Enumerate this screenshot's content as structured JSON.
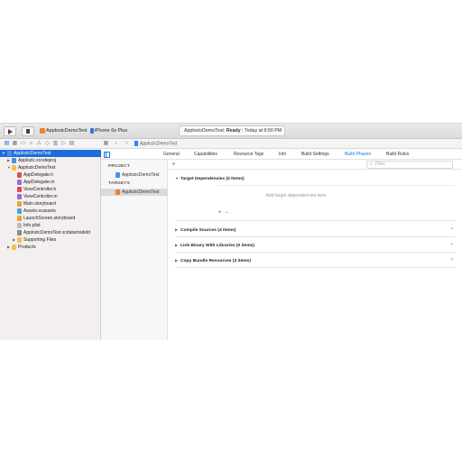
{
  "toolbar": {
    "scheme_name": "ApplozicDemoTest",
    "device_name": "iPhone 6s Plus",
    "status_project": "ApplozicDemoTest:",
    "status_state": "Ready",
    "status_time": "Today at 9:50 PM"
  },
  "jump_bar": {
    "file": "ApplozicDemoTest"
  },
  "navigator": {
    "items": [
      {
        "label": "ApplozicDemoTest",
        "icon": "project-icon",
        "selected": true
      },
      {
        "label": "Applozic.xcodeproj",
        "icon": "xcodeproj-icon"
      },
      {
        "label": "ApplozicDemoTest",
        "icon": "folder-icon"
      },
      {
        "label": "AppDelegate.h",
        "icon": "header-file-icon"
      },
      {
        "label": "AppDelegate.m",
        "icon": "source-file-icon"
      },
      {
        "label": "ViewController.h",
        "icon": "header-file-icon"
      },
      {
        "label": "ViewController.m",
        "icon": "source-file-icon"
      },
      {
        "label": "Main.storyboard",
        "icon": "storyboard-icon"
      },
      {
        "label": "Assets.xcassets",
        "icon": "assets-icon"
      },
      {
        "label": "LaunchScreen.storyboard",
        "icon": "storyboard-icon"
      },
      {
        "label": "Info.plist",
        "icon": "plist-icon"
      },
      {
        "label": "ApplozicDemoTest.xcdatamodeld",
        "icon": "datamodel-icon"
      },
      {
        "label": "Supporting Files",
        "icon": "folder-icon"
      },
      {
        "label": "Products",
        "icon": "folder-icon"
      }
    ]
  },
  "tabs": [
    "General",
    "Capabilities",
    "Resource Tags",
    "Info",
    "Build Settings",
    "Build Phases",
    "Build Rules"
  ],
  "active_tab": "Build Phases",
  "targets_panel": {
    "project_header": "PROJECT",
    "project_item": "ApplozicDemoTest",
    "targets_header": "TARGETS",
    "target_item": "ApplozicDemoTest"
  },
  "phases": {
    "add_symbol": "+",
    "filter_placeholder": "Filter",
    "target_dependencies": "Target Dependencies (0 items)",
    "dependencies_hint": "Add target dependencies here",
    "add_button": "+",
    "remove_button": "−",
    "compile_sources": "Compile Sources (4 items)",
    "link_binary": "Link Binary With Libraries (0 items)",
    "copy_resources": "Copy Bundle Resources (3 items)",
    "close_symbol": "×"
  },
  "colors": {
    "accent": "#1a73e8",
    "selection": "#1a6ddb",
    "sidebar_bg": "#f2efee"
  }
}
